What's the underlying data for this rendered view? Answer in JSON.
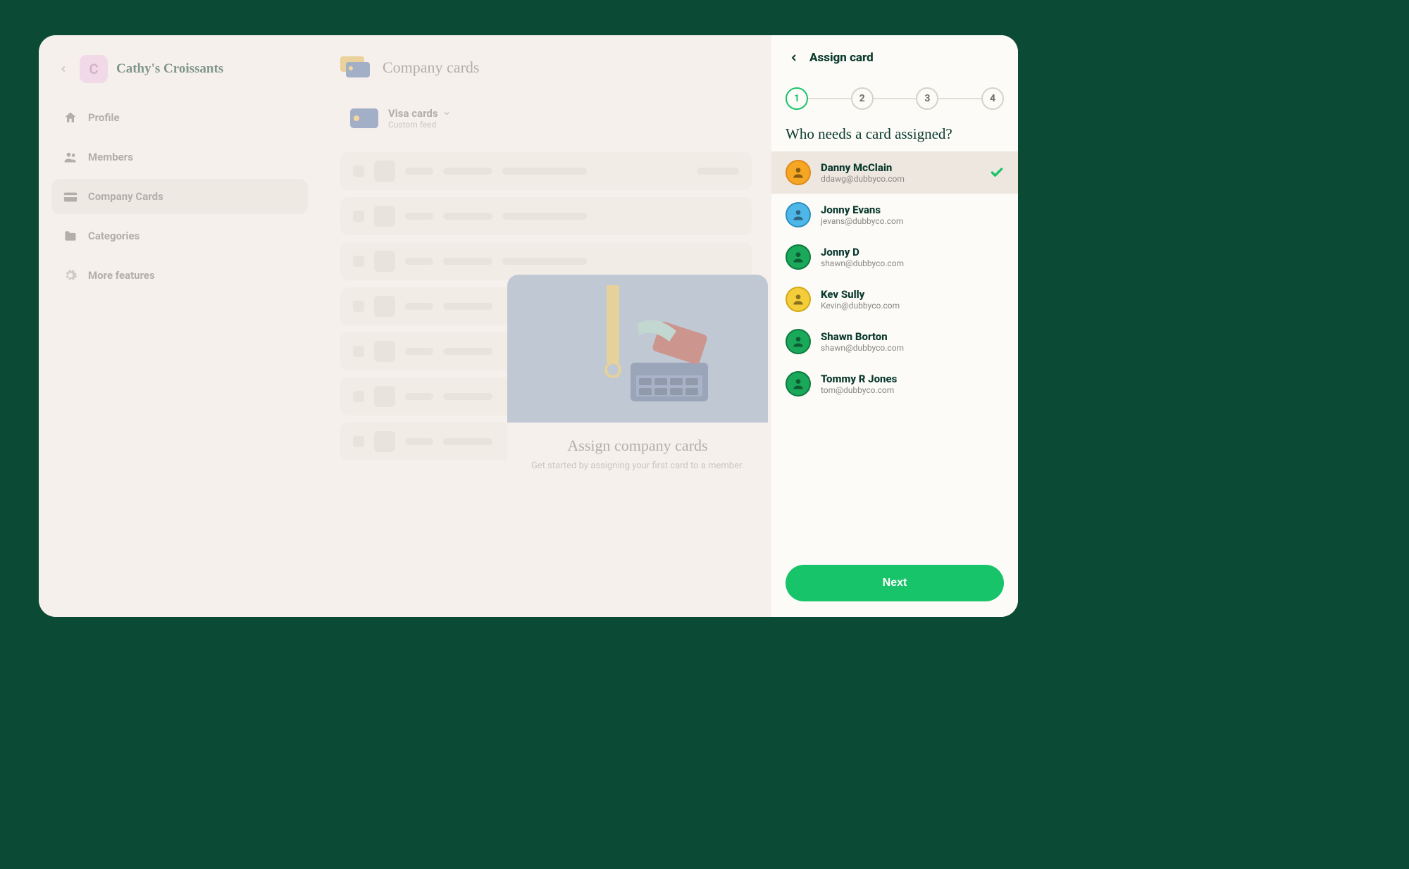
{
  "workspace": {
    "initial": "C",
    "name": "Cathy's Croissants"
  },
  "sidebar": {
    "items": [
      {
        "label": "Profile"
      },
      {
        "label": "Members"
      },
      {
        "label": "Company Cards"
      },
      {
        "label": "Categories"
      },
      {
        "label": "More features"
      }
    ]
  },
  "main": {
    "title": "Company cards",
    "feed": {
      "name": "Visa cards",
      "subtitle": "Custom feed"
    },
    "promo": {
      "title": "Assign company cards",
      "subtitle": "Get started by assigning your first card to a member."
    }
  },
  "panel": {
    "title": "Assign card",
    "steps": [
      "1",
      "2",
      "3",
      "4"
    ],
    "active_step_index": 0,
    "question": "Who needs a card assigned?",
    "members": [
      {
        "name": "Danny McClain",
        "email": "ddawg@dubbyco.com",
        "avatar_color": "av-orange",
        "selected": true
      },
      {
        "name": "Jonny Evans",
        "email": "jevans@dubbyco.com",
        "avatar_color": "av-blue",
        "selected": false
      },
      {
        "name": "Jonny D",
        "email": "shawn@dubbyco.com",
        "avatar_color": "av-green",
        "selected": false
      },
      {
        "name": "Kev Sully",
        "email": "Kevin@dubbyco.com",
        "avatar_color": "av-yellow",
        "selected": false
      },
      {
        "name": "Shawn Borton",
        "email": "shawn@dubbyco.com",
        "avatar_color": "av-green",
        "selected": false
      },
      {
        "name": "Tommy R Jones",
        "email": "tom@dubbyco.com",
        "avatar_color": "av-green",
        "selected": false
      }
    ],
    "next_label": "Next"
  }
}
